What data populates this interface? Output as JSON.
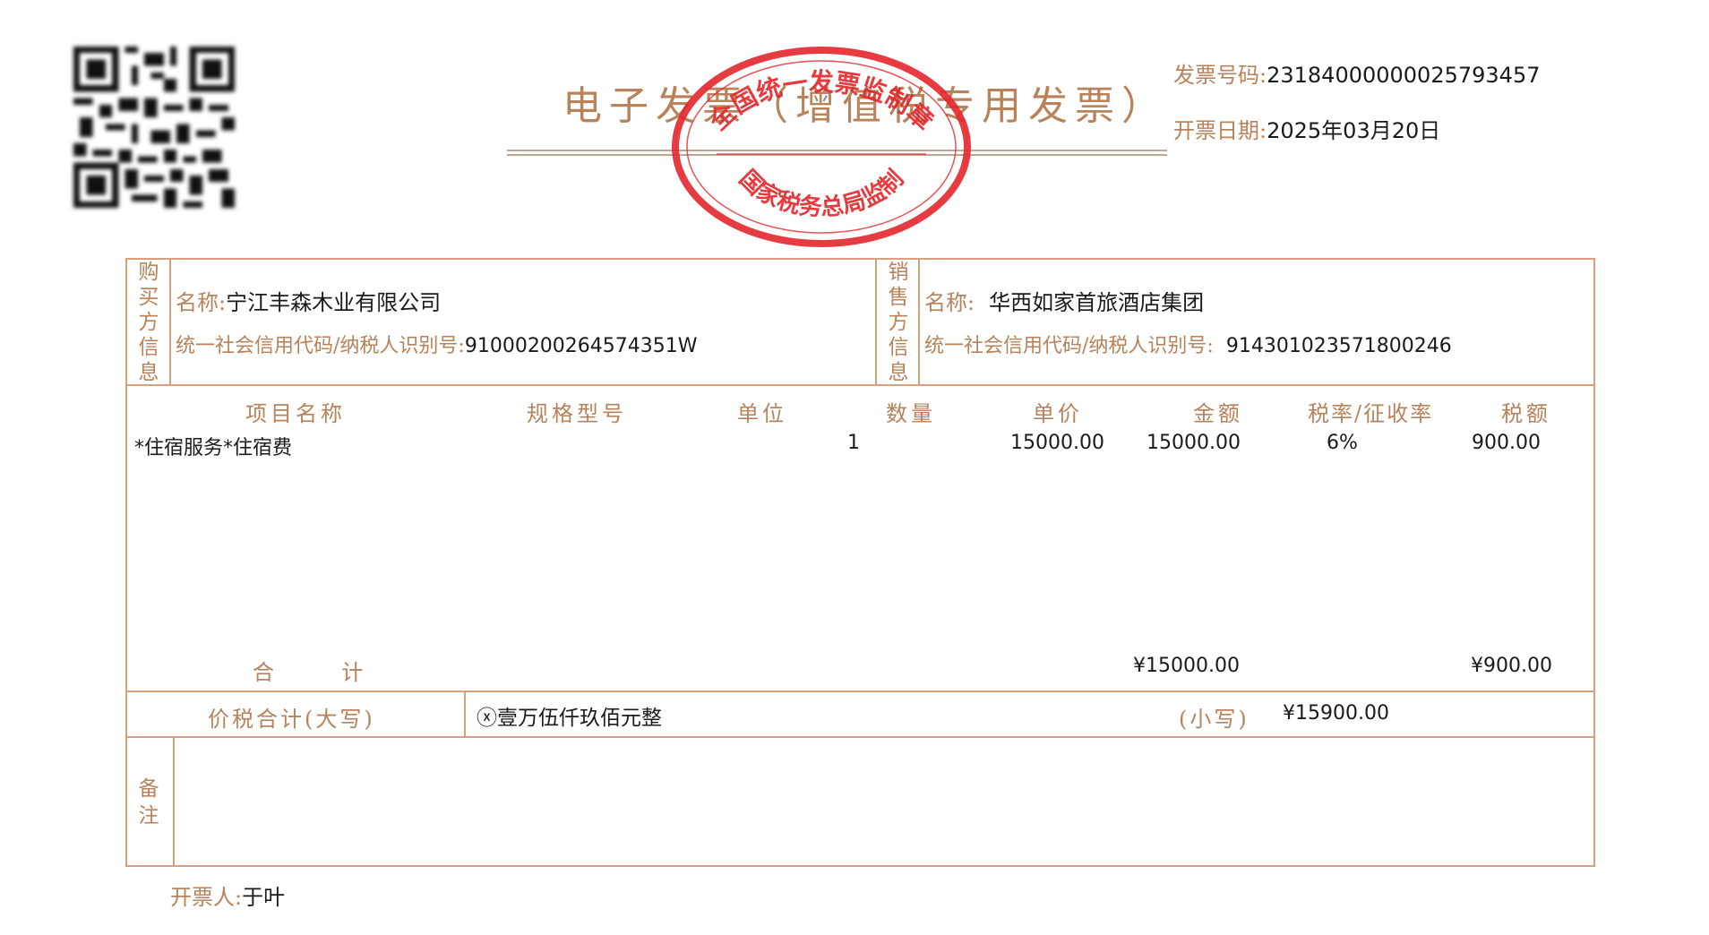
{
  "header": {
    "title": "电子发票（增值税专用发票）",
    "invoice_no_label": "发票号码:",
    "invoice_no": "23184000000025793457",
    "date_label": "开票日期:",
    "date": "2025年03月20日"
  },
  "seal": {
    "top_text": "全国统一发票监制章",
    "bottom_text": "国家税务总局监制",
    "color": "#e3262b"
  },
  "buyer": {
    "side_label": [
      "购",
      "买",
      "方",
      "信",
      "息"
    ],
    "name_label": "名称:",
    "name": "宁江丰森木业有限公司",
    "tax_label": "统一社会信用代码/纳税人识别号:",
    "tax_id": "91000200264574351W"
  },
  "seller": {
    "side_label": [
      "销",
      "售",
      "方",
      "信",
      "息"
    ],
    "name_label": "名称:",
    "name": "华西如家首旅酒店集团",
    "tax_label": "统一社会信用代码/纳税人识别号:",
    "tax_id": "914301023571800246"
  },
  "items": {
    "headers": [
      "项目名称",
      "规格型号",
      "单位",
      "数量",
      "单价",
      "金额",
      "税率/征收率",
      "税额"
    ],
    "rows": [
      {
        "name": "*住宿服务*住宿费",
        "spec": "",
        "unit": "",
        "qty": "1",
        "price": "15000.00",
        "amount": "15000.00",
        "rate": "6%",
        "tax": "900.00"
      }
    ],
    "total_label": "合  计",
    "total_amount": "¥15000.00",
    "total_tax": "¥900.00"
  },
  "grand_total": {
    "label": "价税合计(大写)",
    "words": "ⓧ壹万伍仟玖佰元整",
    "small_label": "(小写)",
    "small": "¥15900.00"
  },
  "remarks": {
    "side_label": [
      "备",
      "注"
    ]
  },
  "issuer": {
    "label": "开票人:",
    "name": "于叶"
  },
  "colors": {
    "frame": "#d9a07b",
    "label": "#b8825a"
  },
  "icons": [
    "qr-code-icon",
    "official-seal-icon"
  ]
}
